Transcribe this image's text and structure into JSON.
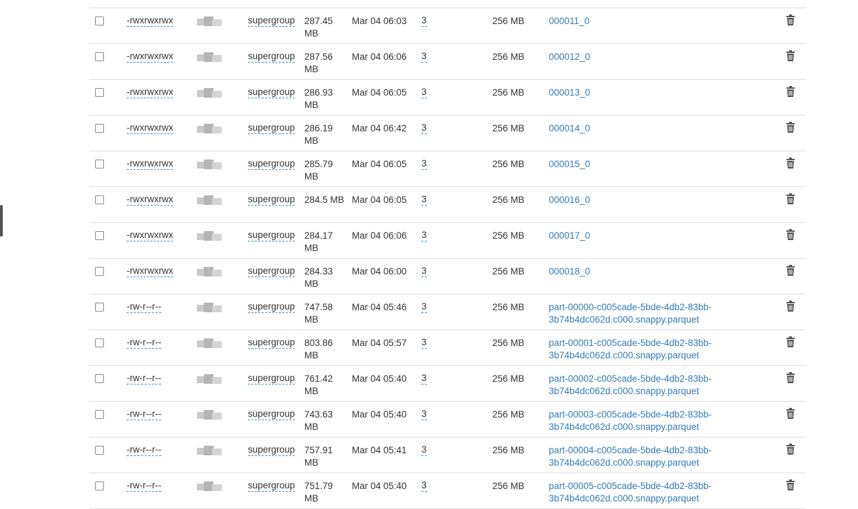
{
  "rows": [
    {
      "perm": "-rwxrwxrwx",
      "group": "supergroup",
      "size": "287.45 MB",
      "date": "Mar 04 06:03",
      "replication": "3",
      "block": "256 MB",
      "name": "000011_0"
    },
    {
      "perm": "-rwxrwxrwx",
      "group": "supergroup",
      "size": "287.56 MB",
      "date": "Mar 04 06:06",
      "replication": "3",
      "block": "256 MB",
      "name": "000012_0"
    },
    {
      "perm": "-rwxrwxrwx",
      "group": "supergroup",
      "size": "286.93 MB",
      "date": "Mar 04 06:05",
      "replication": "3",
      "block": "256 MB",
      "name": "000013_0"
    },
    {
      "perm": "-rwxrwxrwx",
      "group": "supergroup",
      "size": "286.19 MB",
      "date": "Mar 04 06:42",
      "replication": "3",
      "block": "256 MB",
      "name": "000014_0"
    },
    {
      "perm": "-rwxrwxrwx",
      "group": "supergroup",
      "size": "285.79 MB",
      "date": "Mar 04 06:05",
      "replication": "3",
      "block": "256 MB",
      "name": "000015_0"
    },
    {
      "perm": "-rwxrwxrwx",
      "group": "supergroup",
      "size": "284.5 MB",
      "date": "Mar 04 06:05",
      "replication": "3",
      "block": "256 MB",
      "name": "000016_0"
    },
    {
      "perm": "-rwxrwxrwx",
      "group": "supergroup",
      "size": "284.17 MB",
      "date": "Mar 04 06:06",
      "replication": "3",
      "block": "256 MB",
      "name": "000017_0"
    },
    {
      "perm": "-rwxrwxrwx",
      "group": "supergroup",
      "size": "284.33 MB",
      "date": "Mar 04 06:00",
      "replication": "3",
      "block": "256 MB",
      "name": "000018_0"
    },
    {
      "perm": "-rw-r--r--",
      "group": "supergroup",
      "size": "747.58 MB",
      "date": "Mar 04 05:46",
      "replication": "3",
      "block": "256 MB",
      "name": "part-00000-c005cade-5bde-4db2-83bb-3b74b4dc062d.c000.snappy.parquet"
    },
    {
      "perm": "-rw-r--r--",
      "group": "supergroup",
      "size": "803.86 MB",
      "date": "Mar 04 05:57",
      "replication": "3",
      "block": "256 MB",
      "name": "part-00001-c005cade-5bde-4db2-83bb-3b74b4dc062d.c000.snappy.parquet"
    },
    {
      "perm": "-rw-r--r--",
      "group": "supergroup",
      "size": "761.42 MB",
      "date": "Mar 04 05:40",
      "replication": "3",
      "block": "256 MB",
      "name": "part-00002-c005cade-5bde-4db2-83bb-3b74b4dc062d.c000.snappy.parquet"
    },
    {
      "perm": "-rw-r--r--",
      "group": "supergroup",
      "size": "743.63 MB",
      "date": "Mar 04 05:40",
      "replication": "3",
      "block": "256 MB",
      "name": "part-00003-c005cade-5bde-4db2-83bb-3b74b4dc062d.c000.snappy.parquet"
    },
    {
      "perm": "-rw-r--r--",
      "group": "supergroup",
      "size": "757.91 MB",
      "date": "Mar 04 05:41",
      "replication": "3",
      "block": "256 MB",
      "name": "part-00004-c005cade-5bde-4db2-83bb-3b74b4dc062d.c000.snappy.parquet"
    },
    {
      "perm": "-rw-r--r--",
      "group": "supergroup",
      "size": "751.79 MB",
      "date": "Mar 04 05:40",
      "replication": "3",
      "block": "256 MB",
      "name": "part-00005-c005cade-5bde-4db2-83bb-3b74b4dc062d.c000.snappy.parquet"
    }
  ],
  "icons": {
    "delete": "trash-icon",
    "select": "checkbox"
  },
  "colors": {
    "link": "#337ab7",
    "dotted_underline": "#3c8dcd",
    "row_border": "#dddddd"
  }
}
